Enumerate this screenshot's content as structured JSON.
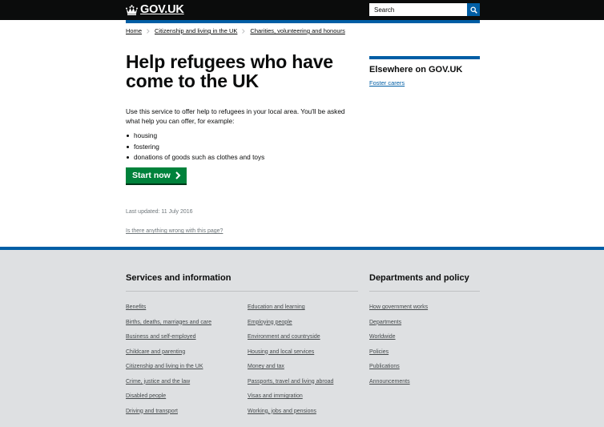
{
  "header": {
    "logo_text": "GOV.UK",
    "search_placeholder": "Search"
  },
  "breadcrumb": [
    "Home",
    "Citizenship and living in the UK",
    "Charities, volunteering and honours"
  ],
  "main": {
    "title": "Help refugees who have come to the UK",
    "intro": "Use this service to offer help to refugees in your local area. You'll be asked what help you can offer, for example:",
    "bullets": [
      "housing",
      "fostering",
      "donations of goods such as clothes and toys"
    ],
    "start_button": "Start now",
    "last_updated": "Last updated: 11 July 2016",
    "report_link": "Is there anything wrong with this page?"
  },
  "aside": {
    "title": "Elsewhere on GOV.UK",
    "links": [
      "Foster carers"
    ]
  },
  "footer": {
    "services_title": "Services and information",
    "services_col1": [
      "Benefits",
      "Births, deaths, marriages and care",
      "Business and self-employed",
      "Childcare and parenting",
      "Citizenship and living in the UK",
      "Crime, justice and the law",
      "Disabled people",
      "Driving and transport"
    ],
    "services_col2": [
      "Education and learning",
      "Employing people",
      "Environment and countryside",
      "Housing and local services",
      "Money and tax",
      "Passports, travel and living abroad",
      "Visas and immigration",
      "Working, jobs and pensions"
    ],
    "departments_title": "Departments and policy",
    "departments": [
      "How government works",
      "Departments",
      "Worldwide",
      "Policies",
      "Publications",
      "Announcements"
    ]
  },
  "colors": {
    "header_bg": "#0b0c0c",
    "link": "#005ea5",
    "button_green": "#00823b",
    "footer_bg": "#dee0e2"
  },
  "icons": [
    "crown-icon",
    "search-icon",
    "chevron-right-icon",
    "arrow-right-icon"
  ]
}
